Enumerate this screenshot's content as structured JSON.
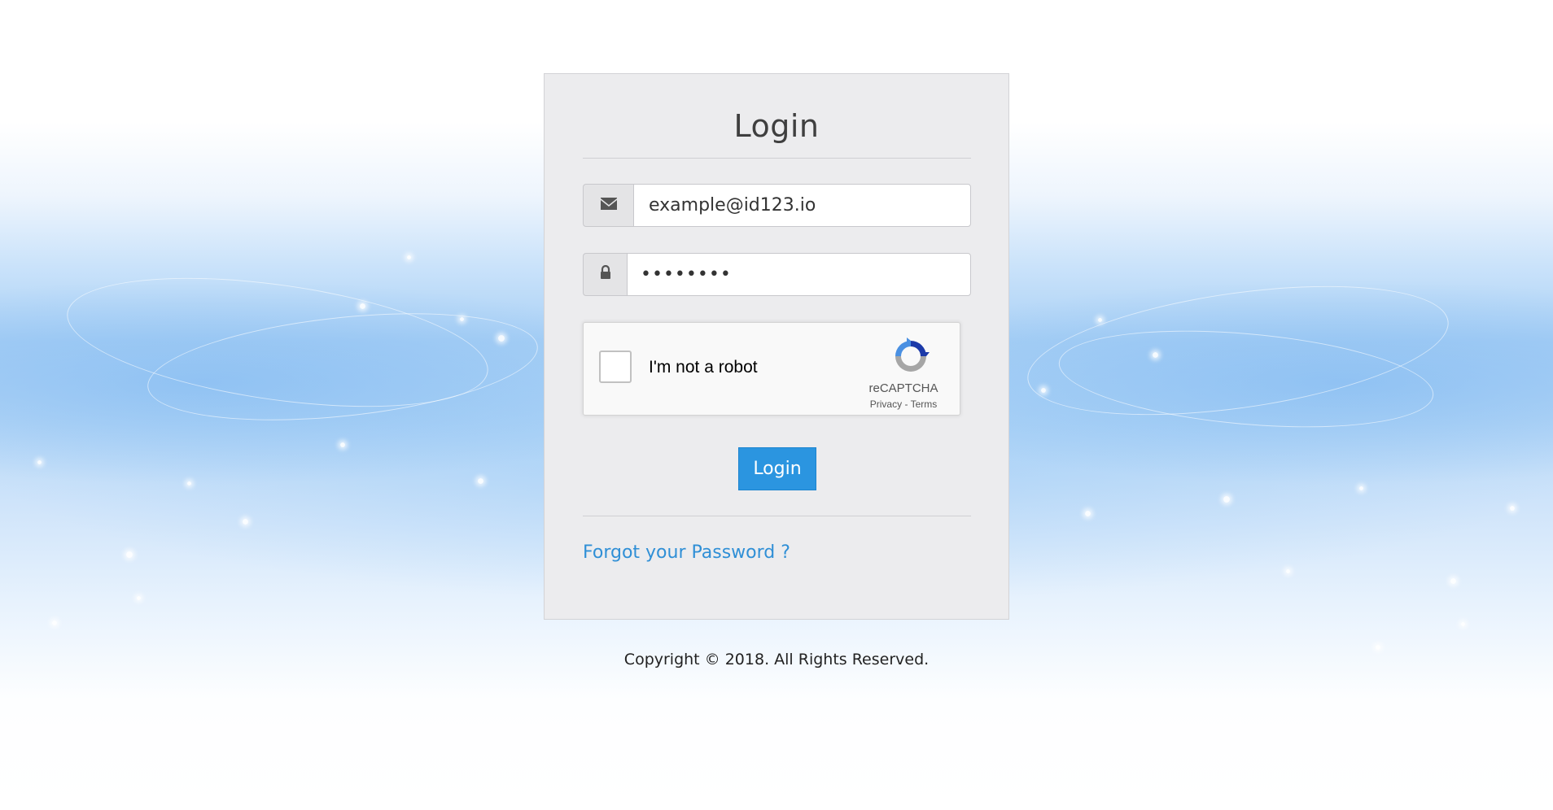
{
  "login_panel": {
    "title": "Login",
    "email": {
      "icon": "envelope-icon",
      "value": "example@id123.io"
    },
    "password": {
      "icon": "lock-icon",
      "value": "••••••••"
    },
    "recaptcha": {
      "label": "I'm not a robot",
      "brand": "reCAPTCHA",
      "privacy": "Privacy",
      "separator": " - ",
      "terms": "Terms",
      "icon": "recaptcha-logo-icon"
    },
    "submit_label": "Login",
    "forgot_password": "Forgot your Password ?"
  },
  "footer": {
    "copyright": "Copyright © 2018. All Rights Reserved."
  },
  "colors": {
    "button": "#2b95e0",
    "link": "#2f8fd6",
    "panel": "#ececee"
  }
}
